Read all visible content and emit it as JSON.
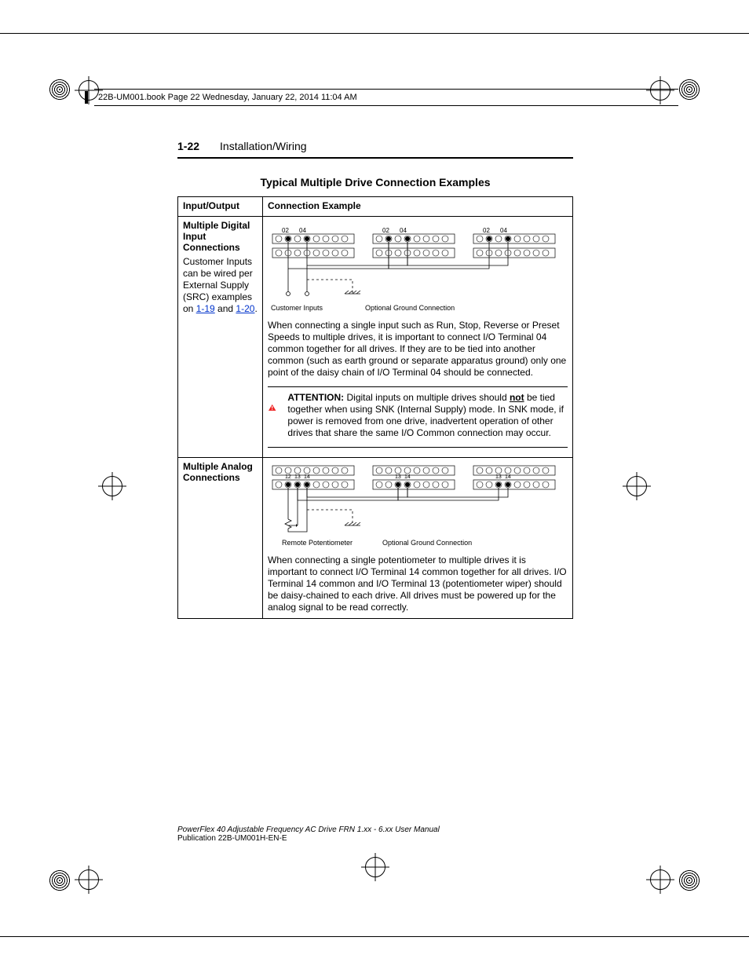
{
  "book_header": "22B-UM001.book  Page 22  Wednesday, January 22, 2014  11:04 AM",
  "page_number": "1-22",
  "section_name": "Installation/Wiring",
  "title": "Typical Multiple Drive Connection Examples",
  "table": {
    "head_io": "Input/Output",
    "head_ex": "Connection Example",
    "row1": {
      "label": "Multiple Digital Input Connections",
      "desc_pre": "Customer Inputs can be wired per External Supply (SRC) examples on ",
      "xref1": "1-19",
      "desc_mid": " and ",
      "xref2": "1-20",
      "desc_post": ".",
      "terminals": [
        "02",
        "04",
        "02",
        "04",
        "02",
        "04"
      ],
      "diag_caption_left": "Customer Inputs",
      "diag_caption_right": "Optional Ground Connection",
      "body": "When connecting a single input such as Run, Stop, Reverse or Preset Speeds to multiple drives, it is important to connect I/O Terminal 04 common together for all drives. If they are to be tied into another common (such as earth ground or separate apparatus ground) only one point of the daisy chain of I/O Terminal 04 should be connected.",
      "attention_lead": "ATTENTION:",
      "attention_body_a": "  Digital inputs on multiple drives should ",
      "attention_not": "not",
      "attention_body_b": " be tied together when using SNK (Internal Supply) mode. In SNK mode, if power is removed from one drive, inadvertent operation of other drives that share the same I/O Common connection may occur."
    },
    "row2": {
      "label": "Multiple Analog Connections",
      "terminals": [
        "12",
        "13",
        "14",
        "13",
        "14",
        "13",
        "14"
      ],
      "diag_caption_left": "Remote Potentiometer",
      "diag_caption_right": "Optional Ground Connection",
      "body": "When connecting a single potentiometer to multiple drives it is important to connect I/O Terminal 14 common together for all drives. I/O Terminal 14 common and I/O Terminal 13 (potentiometer wiper) should be daisy-chained to each drive. All drives must be powered up for the analog signal to be read correctly."
    }
  },
  "footer": {
    "title": "PowerFlex 40 Adjustable Frequency AC Drive FRN 1.xx - 6.xx User Manual",
    "pub": "Publication 22B-UM001H-EN-E"
  }
}
